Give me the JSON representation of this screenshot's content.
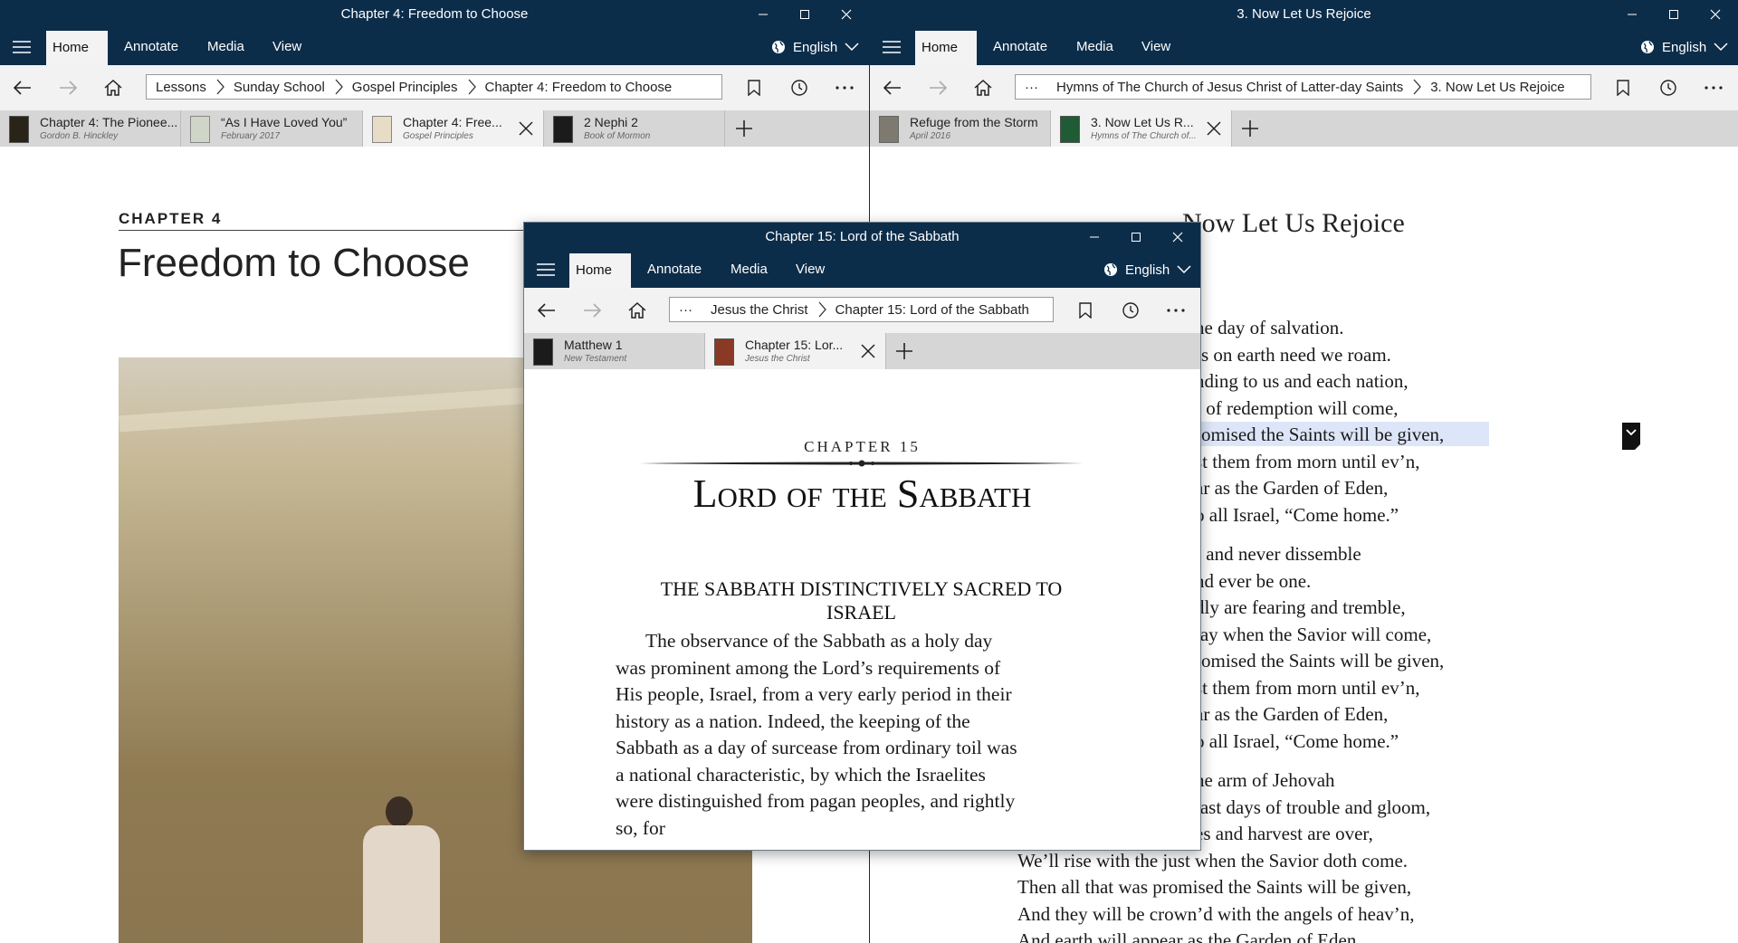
{
  "left": {
    "title": "Chapter 4: Freedom to Choose",
    "menu": [
      "Home",
      "Annotate",
      "Media",
      "View"
    ],
    "language": "English",
    "breadcrumb": [
      "Lessons",
      "Sunday School",
      "Gospel Principles",
      "Chapter 4: Freedom to Choose"
    ],
    "tabs": [
      {
        "title": "Chapter 4: The Pionee...",
        "sub": "Gordon B. Hinckley"
      },
      {
        "title": "“As I Have Loved You”",
        "sub": "February 2017"
      },
      {
        "title": "Chapter 4: Free...",
        "sub": "Gospel Principles"
      },
      {
        "title": "2 Nephi 2",
        "sub": "Book of Mormon"
      }
    ],
    "chapter_label": "CHAPTER 4",
    "heading": "Freedom to Choose"
  },
  "right": {
    "title": "3. Now Let Us Rejoice",
    "menu": [
      "Home",
      "Annotate",
      "Media",
      "View"
    ],
    "language": "English",
    "breadcrumb_more": "···",
    "breadcrumb": [
      "Hymns of The Church of Jesus Christ of Latter-day Saints",
      "3. Now Let Us Rejoice"
    ],
    "tabs": [
      {
        "title": "Refuge from the Storm",
        "sub": "April 2016"
      },
      {
        "title": "3. Now Let Us R...",
        "sub": "Hymns of The Church of..."
      }
    ],
    "heading_fragment": "Now Let Us Rejoice",
    "lines": [
      "he day of salvation.",
      "rs on earth need we roam.",
      "nding to us and each nation,",
      "r of redemption will come,",
      "romised the Saints will be given,",
      "st them from morn until ev’n,",
      "ar as the Garden of Eden,",
      "o all Israel, “Come home.”",
      "r and never dissemble",
      "nd ever be one.",
      "dly are fearing and tremble,",
      "lay when the Savior will come,",
      "romised the Saints will be given,",
      "st them from morn until ev’n,",
      "ar as the Garden of Eden,",
      "o all Israel, “Come home.”",
      "he arm of Jehovah",
      "last days of trouble and gloom,",
      "es and harvest are over,",
      "We’ll rise with the just when the Savior doth come.",
      "Then all that was promised the Saints will be given,",
      "And they will be crown’d with the angels of heav’n,",
      "And earth will appear as the Garden of Eden"
    ]
  },
  "center": {
    "title": "Chapter 15: Lord of the Sabbath",
    "menu": [
      "Home",
      "Annotate",
      "Media",
      "View"
    ],
    "language": "English",
    "breadcrumb_more": "···",
    "breadcrumb": [
      "Jesus the Christ",
      "Chapter 15: Lord of the Sabbath"
    ],
    "tabs": [
      {
        "title": "Matthew 1",
        "sub": "New Testament"
      },
      {
        "title": "Chapter 15: Lor...",
        "sub": "Jesus the Christ"
      }
    ],
    "chapter_label": "CHAPTER 15",
    "heading": "Lord of the Sabbath",
    "section_heading": "THE SABBATH DISTINCTIVELY SACRED TO ISRAEL",
    "paragraph": "The observance of the Sabbath as a holy day was prominent among the Lord’s requirements of His people, Israel, from a very early period in their history as a nation. Indeed, the keeping of the Sabbath as a day of surcease from ordinary toil was a national characteristic, by which the Israelites were distinguished from pagan peoples, and rightly so, for"
  },
  "colors": {
    "titlebar": "#0c2d4a",
    "highlight": "#dde6f8",
    "tabbar": "#d6d6d6"
  }
}
